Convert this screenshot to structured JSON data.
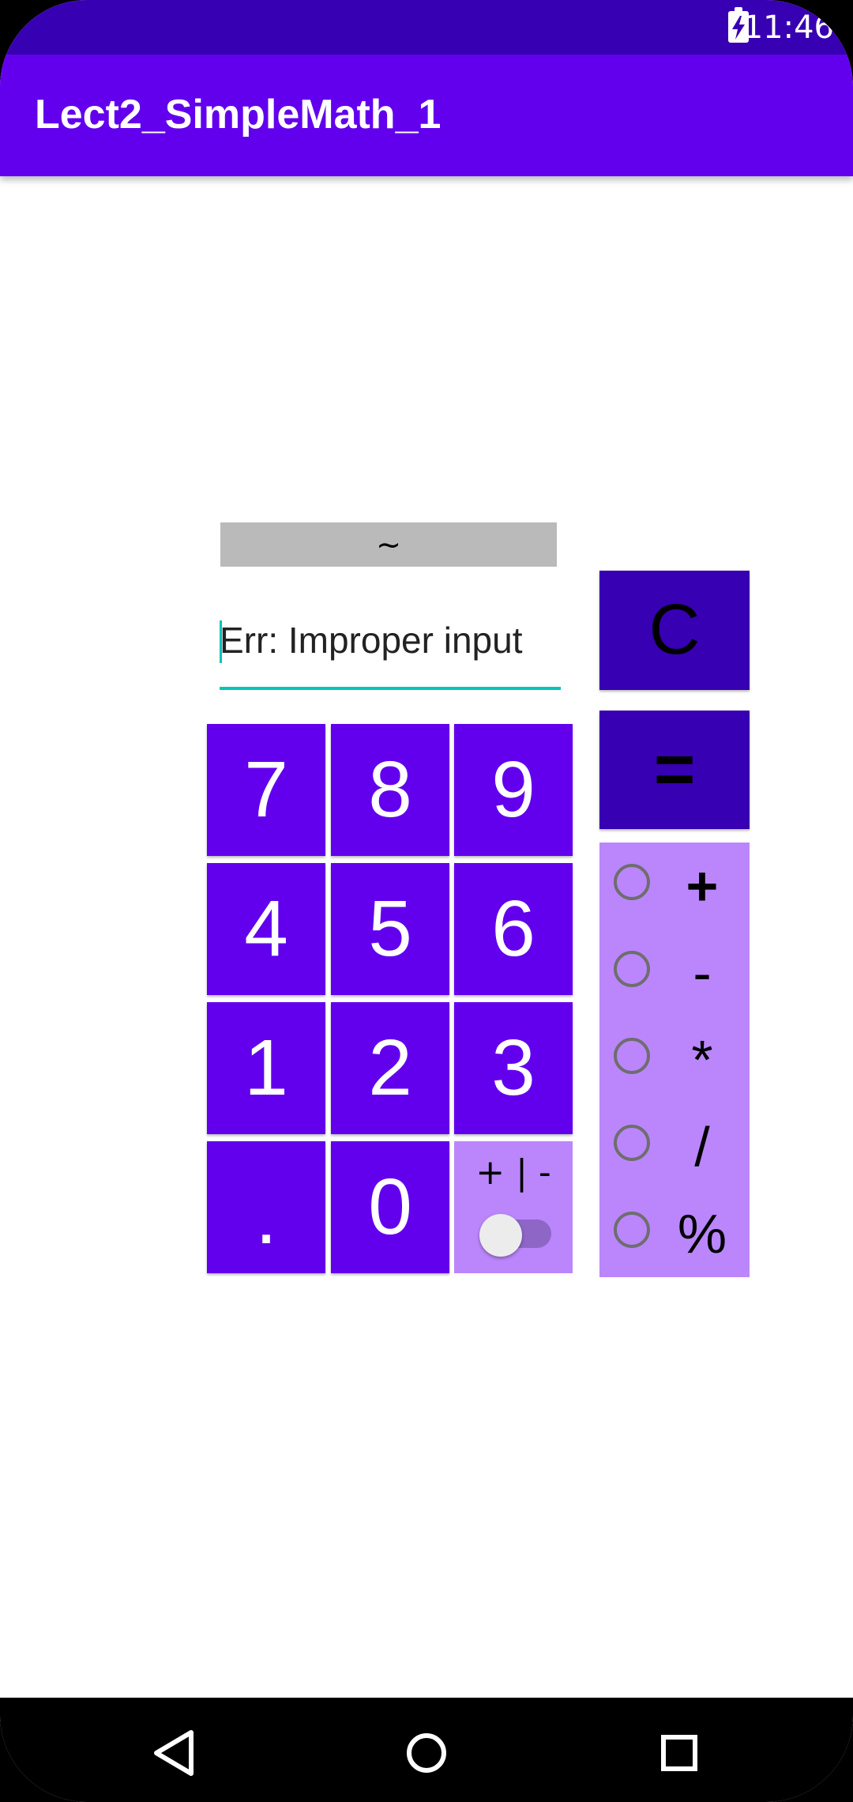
{
  "status_bar": {
    "time": "11:46",
    "battery_icon": "battery-charging-icon"
  },
  "app_bar": {
    "title": "Lect2_SimpleMath_1"
  },
  "calculator": {
    "result_label": "~",
    "input_value": "Err: Improper input",
    "keypad": {
      "key_7": "7",
      "key_8": "8",
      "key_9": "9",
      "key_4": "4",
      "key_5": "5",
      "key_6": "6",
      "key_1": "1",
      "key_2": "2",
      "key_3": "3",
      "key_dot": ".",
      "key_0": "0"
    },
    "sign_toggle": {
      "label": "+ | -",
      "checked": false
    },
    "clear_label": "C",
    "equals_label": "=",
    "operators": [
      "+",
      "-",
      "*",
      "/",
      "%"
    ]
  },
  "nav_bar": {
    "icons": [
      "back-icon",
      "home-icon",
      "recents-icon"
    ]
  },
  "colors": {
    "primary": "#6200EE",
    "primary_dark": "#3700B3",
    "accent_light": "#BB86FC",
    "input_accent": "#03C5BA"
  }
}
